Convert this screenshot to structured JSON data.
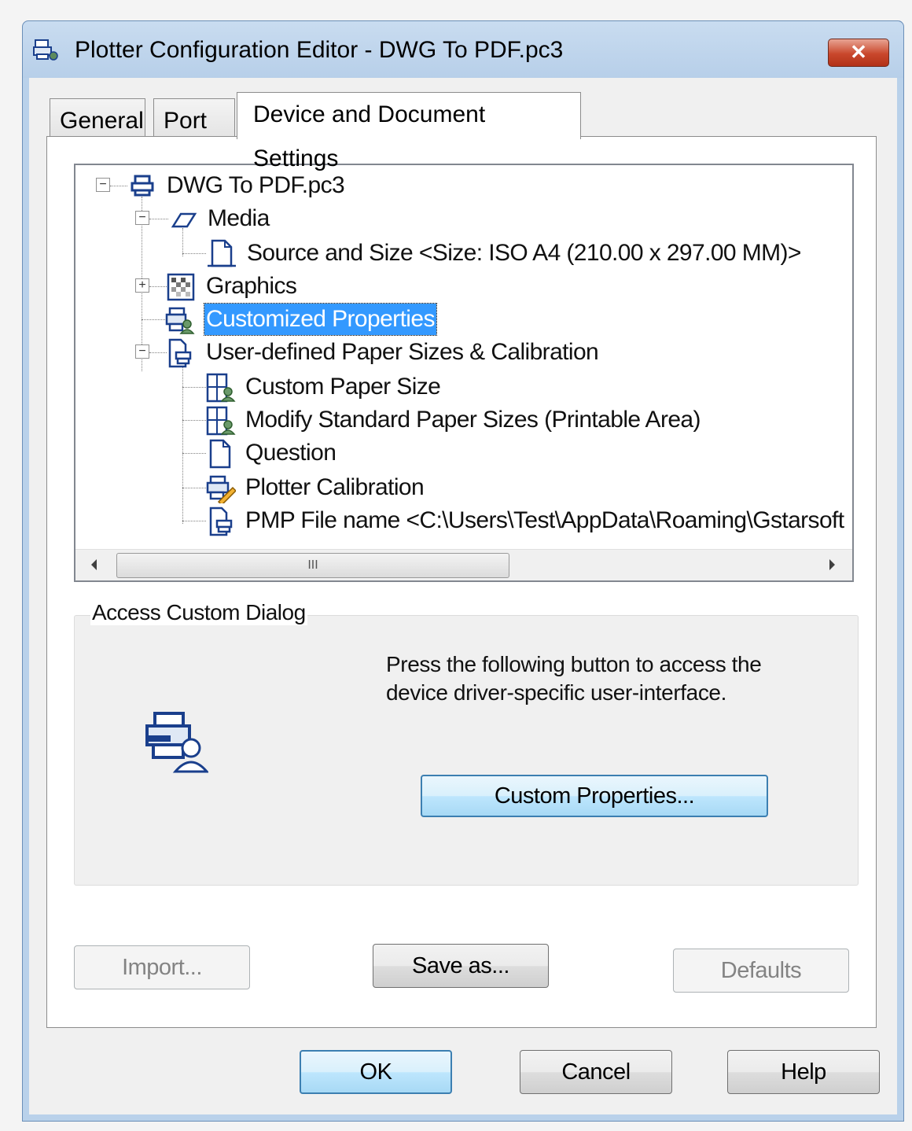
{
  "window": {
    "title": "Plotter Configuration Editor - DWG To PDF.pc3",
    "close_label": "✕"
  },
  "tabs": [
    {
      "label": "General"
    },
    {
      "label": "Port"
    },
    {
      "label": "Device and Document Settings"
    }
  ],
  "tree": {
    "nodes": [
      {
        "label": "DWG To PDF.pc3",
        "icon": "printer-icon"
      },
      {
        "label": "Media",
        "icon": "media-icon"
      },
      {
        "label": "Source and Size <Size: ISO A4 (210.00 x 297.00 MM)>",
        "icon": "page-icon"
      },
      {
        "label": "Graphics",
        "icon": "graphics-icon"
      },
      {
        "label": "Customized Properties",
        "icon": "custom-properties-icon"
      },
      {
        "label": "User-defined Paper Sizes & Calibration",
        "icon": "paper-sizes-icon"
      },
      {
        "label": "Custom Paper Size",
        "icon": "custom-paper-icon"
      },
      {
        "label": "Modify Standard Paper Sizes (Printable Area)",
        "icon": "modify-paper-icon"
      },
      {
        "label": "Question",
        "icon": "document-icon"
      },
      {
        "label": "Plotter Calibration",
        "icon": "calibration-icon"
      },
      {
        "label": "PMP File name <C:\\Users\\Test\\AppData\\Roaming\\Gstarsoft",
        "icon": "pmp-file-icon"
      }
    ],
    "scroll_thumb_grip": "III"
  },
  "group": {
    "label": "Access Custom Dialog",
    "description_line1": "Press the following button to access the",
    "description_line2": "device driver-specific user-interface.",
    "custom_button": "Custom Properties..."
  },
  "panel_buttons": {
    "import": "Import...",
    "save_as": "Save as...",
    "defaults": "Defaults"
  },
  "dialog_buttons": {
    "ok": "OK",
    "cancel": "Cancel",
    "help": "Help"
  }
}
